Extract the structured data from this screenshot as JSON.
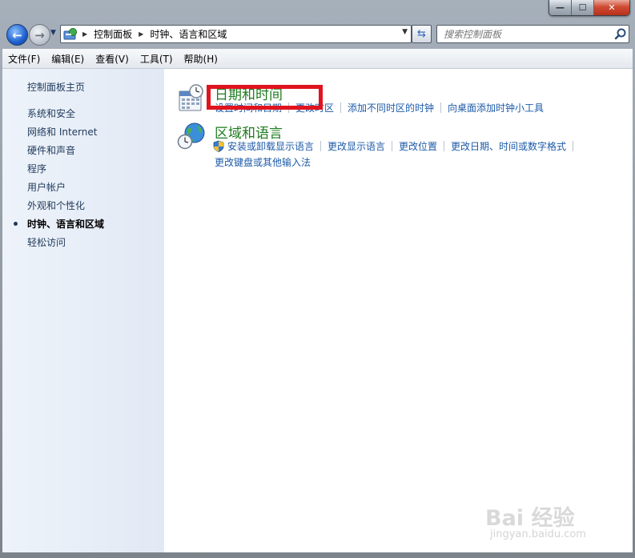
{
  "window": {
    "caption_buttons": {
      "minimize": "—",
      "maximize": "☐",
      "close": "✕"
    }
  },
  "address_bar": {
    "breadcrumbs": [
      "控制面板",
      "时钟、语言和区域"
    ],
    "search_placeholder": "搜索控制面板"
  },
  "menu": [
    {
      "label": "文件(F)"
    },
    {
      "label": "编辑(E)"
    },
    {
      "label": "查看(V)"
    },
    {
      "label": "工具(T)"
    },
    {
      "label": "帮助(H)"
    }
  ],
  "sidebar": {
    "home": "控制面板主页",
    "items": [
      {
        "label": "系统和安全"
      },
      {
        "label": "网络和 Internet"
      },
      {
        "label": "硬件和声音"
      },
      {
        "label": "程序"
      },
      {
        "label": "用户帐户"
      },
      {
        "label": "外观和个性化"
      },
      {
        "label": "时钟、语言和区域"
      },
      {
        "label": "轻松访问"
      }
    ],
    "active_index": 6
  },
  "categories": [
    {
      "title": "日期和时间",
      "icon": "calendar-clock-icon",
      "tasks": [
        "设置时间和日期",
        "更改时区",
        "添加不同时区的时钟",
        "向桌面添加时钟小工具"
      ]
    },
    {
      "title": "区域和语言",
      "icon": "globe-clock-icon",
      "tasks": [
        "安装或卸载显示语言",
        "更改显示语言",
        "更改位置",
        "更改日期、时间或数字格式"
      ],
      "tasks_row2": [
        "更改键盘或其他输入法"
      ]
    }
  ],
  "watermark": {
    "logo": "Bai 经验",
    "url": "jingyan.baidu.com"
  },
  "colors": {
    "category_title": "#1e7b1e",
    "task_link": "#1c5aa8",
    "highlight_box": "#e0141e"
  }
}
